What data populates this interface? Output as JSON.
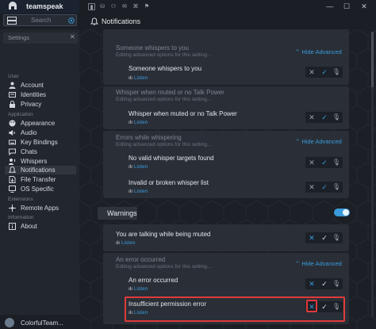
{
  "app": {
    "name": "teamspeak"
  },
  "window_controls": {
    "minimize": "—",
    "maximize": "☐",
    "close": "✕"
  },
  "search": {
    "placeholder": "Search"
  },
  "panel": {
    "title": "Notifications"
  },
  "settings": {
    "header": "Settings",
    "close": "✕",
    "categories": [
      {
        "label": "User",
        "items": [
          "Account",
          "Identities",
          "Privacy"
        ]
      },
      {
        "label": "Application",
        "items": [
          "Appearance",
          "Audio",
          "Key Bindings",
          "Chats",
          "Whispers",
          "Notifications",
          "File Transfer",
          "OS Specific"
        ]
      },
      {
        "label": "Extensions",
        "items": [
          "Remote Apps"
        ]
      },
      {
        "label": "Information",
        "items": [
          "About"
        ]
      }
    ],
    "active_item": "Notifications"
  },
  "user": {
    "name": "ColorfulTeam..."
  },
  "groups": [
    {
      "title": "Someone whispers to you",
      "subtitle": "Editing advanced options for this setting...",
      "hide": "Hide Advanced",
      "rows": [
        {
          "title": "Someone whispers to you",
          "listen": "Listen"
        }
      ]
    },
    {
      "title": "Whisper when muted or no Talk Power",
      "subtitle": "Editing advanced options for this setting...",
      "rows": [
        {
          "title": "Whisper when muted or no Talk Power",
          "listen": "Listen"
        }
      ]
    },
    {
      "title": "Errors while whispering",
      "subtitle": "Editing advanced options for this setting...",
      "hide": "Hide Advanced",
      "rows": [
        {
          "title": "No valid whisper targets found",
          "listen": "Listen"
        },
        {
          "title": "Invalid or broken whisper list",
          "listen": "Listen"
        }
      ]
    }
  ],
  "warnings": {
    "label": "Warnings",
    "enabled": true,
    "muted_row": {
      "title": "You are talking while being muted",
      "listen": "Listen"
    },
    "group": {
      "title": "An error occurred",
      "subtitle": "Editing advanced options for this setting...",
      "hide": "Hide Advanced",
      "rows": [
        {
          "title": "An error occurred",
          "listen": "Listen"
        },
        {
          "title": "Insufficient permission error",
          "listen": "Listen"
        }
      ]
    }
  },
  "controls": {
    "x": "✕",
    "check": "✓",
    "mic": "🎙"
  },
  "colors": {
    "accent": "#3a9bdc",
    "highlight": "#e03a3a"
  }
}
